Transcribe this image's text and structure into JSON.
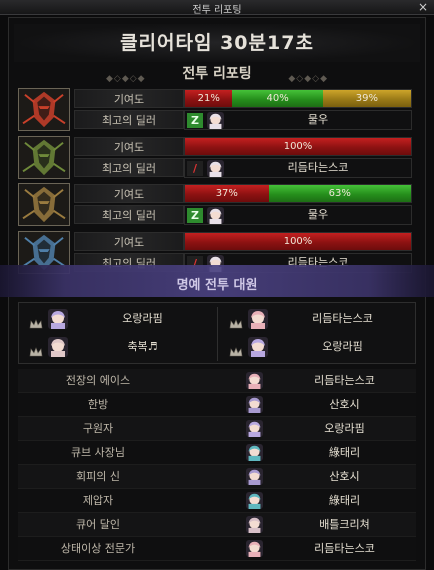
{
  "window": {
    "title": "전투 리포팅",
    "close_glyph": "×"
  },
  "clear_time": "클리어타임  30분17초",
  "report_title": "전투 리포팅",
  "labels": {
    "contribution": "기여도",
    "best_dealer": "최고의 딜러"
  },
  "party": [
    {
      "portrait_icon": "red-warrior-portrait-icon",
      "portrait_color": "#c9402a",
      "contribution": [
        {
          "pct": 21,
          "text": "21%",
          "color": "red"
        },
        {
          "pct": 40,
          "text": "40%",
          "color": "green"
        },
        {
          "pct": 39,
          "text": "39%",
          "color": "gold"
        }
      ],
      "best_dealer": {
        "class_glyph": "Z",
        "class_color": "green",
        "name": "물우"
      }
    },
    {
      "portrait_icon": "green-warrior-portrait-icon",
      "portrait_color": "#6f8a3a",
      "contribution": [
        {
          "pct": 100,
          "text": "100%",
          "color": "red"
        }
      ],
      "best_dealer": {
        "class_glyph": "/",
        "class_color": "red",
        "name": "리듬타는스코"
      }
    },
    {
      "portrait_icon": "bronze-warrior-portrait-icon",
      "portrait_color": "#9a7b3f",
      "contribution": [
        {
          "pct": 37,
          "text": "37%",
          "color": "red"
        },
        {
          "pct": 63,
          "text": "63%",
          "color": "green"
        }
      ],
      "best_dealer": {
        "class_glyph": "Z",
        "class_color": "green",
        "name": "물우"
      }
    },
    {
      "portrait_icon": "blue-warrior-portrait-icon",
      "portrait_color": "#4f7fa8",
      "contribution": [
        {
          "pct": 100,
          "text": "100%",
          "color": "red"
        }
      ],
      "best_dealer": {
        "class_glyph": "/",
        "class_color": "red",
        "name": "리듬타는스코"
      }
    }
  ],
  "honor_title": "명예 전투 대원",
  "honor": [
    {
      "name": "오랑라핌",
      "avatar_color": "#b8a8e0"
    },
    {
      "name": "리듬타는스코",
      "avatar_color": "#e8b0b8"
    },
    {
      "name": "축복♬",
      "avatar_color": "#e0c8c8"
    },
    {
      "name": "오랑라핌",
      "avatar_color": "#b8a8e0"
    }
  ],
  "titles": [
    {
      "category": "전장의 에이스",
      "name": "리듬타는스코",
      "avatar_color": "#e8b0b8"
    },
    {
      "category": "한방",
      "name": "산호시",
      "avatar_color": "#a89ad0"
    },
    {
      "category": "구원자",
      "name": "오랑라핌",
      "avatar_color": "#b8a8e0"
    },
    {
      "category": "큐브 사장님",
      "name": "綠태리",
      "avatar_color": "#5fb8c0"
    },
    {
      "category": "회피의 신",
      "name": "산호시",
      "avatar_color": "#a89ad0"
    },
    {
      "category": "제압자",
      "name": "綠태리",
      "avatar_color": "#5fb8c0"
    },
    {
      "category": "큐어 달인",
      "name": "배틀크리쳐",
      "avatar_color": "#d8c0c8"
    },
    {
      "category": "상태이상 전문가",
      "name": "리듬타는스코",
      "avatar_color": "#e8b0b8"
    }
  ]
}
